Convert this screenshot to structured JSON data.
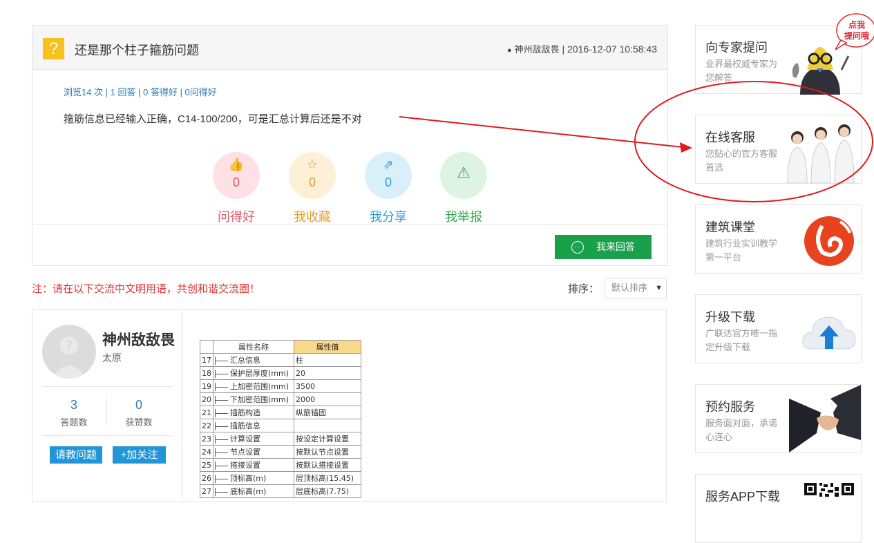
{
  "question": {
    "icon": "question-icon",
    "icon_glyph": "?",
    "title": "还是那个柱子箍筋问题",
    "author": "神州敌敌畏",
    "separator": "|",
    "datetime": "2016-12-07 10:58:43",
    "stats": "浏览14 次 | 1 回答 | 0 答得好 | 0问得好",
    "body": "箍筋信息已经输入正确，C14-100/200，可是汇总计算后还是不对",
    "actions": [
      {
        "icon": "thumbs-up-icon",
        "glyph": "👍",
        "count": "0",
        "label": "问得好",
        "color": "#e05a6a",
        "bg": "#fde1e4"
      },
      {
        "icon": "star-icon",
        "glyph": "☆",
        "count": "0",
        "label": "我收藏",
        "color": "#e0a030",
        "bg": "#fdf0d6"
      },
      {
        "icon": "share-icon",
        "glyph": "⇗",
        "count": "0",
        "label": "我分享",
        "color": "#2a9fd6",
        "bg": "#d9f0fb"
      },
      {
        "icon": "warning-icon",
        "glyph": "⚠",
        "count": "",
        "label": "我举报",
        "color": "#2faa4a",
        "bg": "#def3e3"
      }
    ],
    "answer_button": "我来回答"
  },
  "notice": "注：请在以下交流中文明用语，共创和谐交流圈！",
  "sort": {
    "label": "排序：",
    "selected": "默认排序"
  },
  "answer": {
    "name": "神州敌敌畏",
    "location": "太原",
    "answers_count": "3",
    "answers_label": "答题数",
    "likes_count": "0",
    "likes_label": "获赞数",
    "ask_button": "请教问题",
    "follow_button": "+加关注",
    "table": {
      "headers": [
        "属性名称",
        "属性值"
      ],
      "rows": [
        {
          "idx": "17",
          "name": "汇总信息",
          "value": "柱"
        },
        {
          "idx": "18",
          "name": "保护层厚度(mm)",
          "value": "20"
        },
        {
          "idx": "19",
          "name": "上加密范围(mm)",
          "value": "3500"
        },
        {
          "idx": "20",
          "name": "下加密范围(mm)",
          "value": "2000"
        },
        {
          "idx": "21",
          "name": "插筋构造",
          "value": "纵筋锚固"
        },
        {
          "idx": "22",
          "name": "插筋信息",
          "value": ""
        },
        {
          "idx": "23",
          "name": "计算设置",
          "value": "按设定计算设置"
        },
        {
          "idx": "24",
          "name": "节点设置",
          "value": "按默认节点设置"
        },
        {
          "idx": "25",
          "name": "搭接设置",
          "value": "按默认搭接设置"
        },
        {
          "idx": "26",
          "name": "顶标高(m)",
          "value": "层顶标高(15.45)"
        },
        {
          "idx": "27",
          "name": "底标高(m)",
          "value": "层底标高(7.75)"
        }
      ]
    }
  },
  "sidebar": {
    "badge": "点我\n提问哦",
    "cards": [
      {
        "title": "向专家提问",
        "desc": "业界最权威专家为您解答",
        "icon": "expert-mascot-icon"
      },
      {
        "title": "在线客服",
        "desc": "您贴心的官方客服首选",
        "icon": "customer-service-icon"
      },
      {
        "title": "建筑课堂",
        "desc": "建筑行业实训教学第一平台",
        "icon": "classroom-logo-icon"
      },
      {
        "title": "升级下载",
        "desc": "广联达官方唯一指定升级下载",
        "icon": "cloud-upload-icon"
      },
      {
        "title": "预约服务",
        "desc": "服务面对面，承诺心连心",
        "icon": "handshake-icon"
      },
      {
        "title": "服务APP下载",
        "desc": "",
        "icon": "qr-code-icon"
      }
    ]
  },
  "colors": {
    "accent_green": "#18a14a",
    "accent_blue": "#2196d7",
    "annotation_red": "#e0191b"
  }
}
